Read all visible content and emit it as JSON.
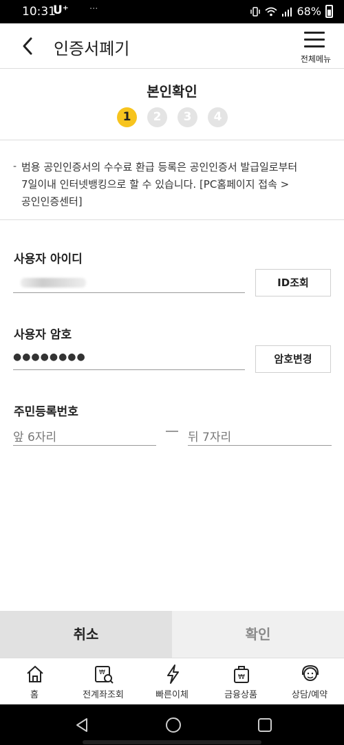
{
  "status_bar": {
    "time": "10:31",
    "carrier": "U⁺",
    "battery": "68%"
  },
  "header": {
    "title": "인증서폐기",
    "menu_label": "전체메뉴"
  },
  "steps": {
    "heading": "본인확인",
    "items": [
      "1",
      "2",
      "3",
      "4"
    ],
    "current": 1
  },
  "notice": {
    "text": "범용 공인인증서의 수수료 환급 등록은 공인인증서 발급일로부터 7일이내 인터넷뱅킹으로 할 수 있습니다. [PC홈페이지 접속 > 공인인증센터]"
  },
  "form": {
    "user_id": {
      "label": "사용자 아이디",
      "button": "ID조회"
    },
    "password": {
      "label": "사용자 암호",
      "value": "●●●●●●●●",
      "button": "암호변경"
    },
    "resident_number": {
      "label": "주민등록번호",
      "front_placeholder": "앞 6자리",
      "back_placeholder": "뒤 7자리"
    }
  },
  "actions": {
    "cancel": "취소",
    "confirm": "확인"
  },
  "tabs": [
    {
      "label": "홈",
      "icon": "home-icon"
    },
    {
      "label": "전계좌조회",
      "icon": "account-search-icon"
    },
    {
      "label": "빠른이체",
      "icon": "lightning-icon"
    },
    {
      "label": "금융상품",
      "icon": "product-bag-icon"
    },
    {
      "label": "상담/예약",
      "icon": "headset-icon"
    }
  ],
  "colors": {
    "accent": "#f7c41e",
    "step_inactive": "#e4e4e4",
    "cancel_bg": "#e1e1e1",
    "confirm_bg": "#f0f0f0"
  }
}
